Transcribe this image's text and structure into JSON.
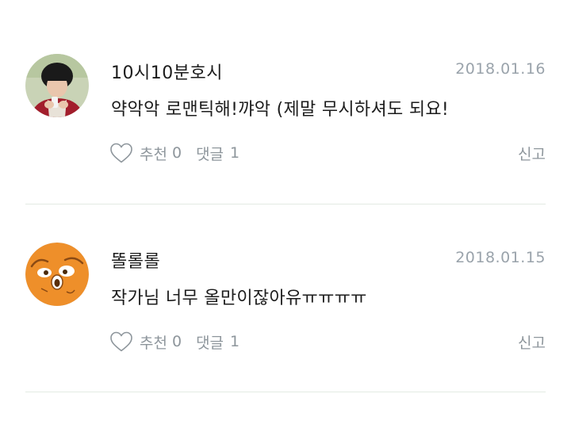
{
  "comments": [
    {
      "author": "10시10분호시",
      "date": "2018.01.16",
      "body": "약악악 로맨틱해!꺄악 (제말 무시하셔도 되요!",
      "like_label": "추천",
      "like_count": "0",
      "reply_label": "댓글",
      "reply_count": "1",
      "report_label": "신고",
      "avatar_icon": "person-photo-avatar"
    },
    {
      "author": "똘롤롤",
      "date": "2018.01.15",
      "body": "작가님 너무 올만이잖아유ㅠㅠㅠㅠ",
      "like_label": "추천",
      "like_count": "0",
      "reply_label": "댓글",
      "reply_count": "1",
      "report_label": "신고",
      "avatar_icon": "cartoon-character-avatar"
    }
  ],
  "colors": {
    "text": "#1c1c1c",
    "meta": "#8e969c",
    "date": "#9aa3ab",
    "divider": "#e3ebe3",
    "accent_orange": "#f0922e"
  }
}
